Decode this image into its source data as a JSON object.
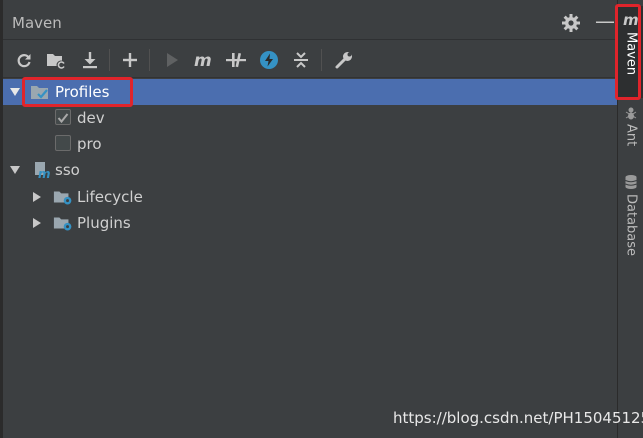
{
  "panel": {
    "title": "Maven",
    "settings_icon": "gear-icon",
    "minimize_label": "—"
  },
  "toolbar": {
    "buttons": [
      {
        "name": "reload-all-button",
        "icon": "refresh-icon"
      },
      {
        "name": "generate-sources-button",
        "icon": "folder-refresh-icon"
      },
      {
        "name": "download-sources-button",
        "icon": "download-icon"
      },
      {
        "name": "add-project-button",
        "icon": "plus-icon"
      },
      {
        "name": "run-button",
        "icon": "play-icon"
      },
      {
        "name": "execute-goal-button",
        "icon": "maven-m-icon"
      },
      {
        "name": "toggle-offline-button",
        "icon": "offline-icon"
      },
      {
        "name": "skip-tests-button",
        "icon": "lightning-icon"
      },
      {
        "name": "collapse-all-button",
        "icon": "collapse-icon"
      },
      {
        "name": "maven-settings-button",
        "icon": "wrench-icon"
      }
    ]
  },
  "tree": {
    "profiles": {
      "label": "Profiles",
      "items": [
        {
          "label": "dev",
          "checked": true
        },
        {
          "label": "pro",
          "checked": false
        }
      ]
    },
    "project": {
      "label": "sso",
      "children": [
        {
          "label": "Lifecycle"
        },
        {
          "label": "Plugins"
        }
      ]
    }
  },
  "sidebar": {
    "items": [
      {
        "label": "Maven",
        "icon": "maven-m-icon",
        "active": true
      },
      {
        "label": "Ant",
        "icon": "ant-icon",
        "active": false
      },
      {
        "label": "Database",
        "icon": "database-icon",
        "active": false
      }
    ]
  },
  "watermark": "https://blog.csdn.net/PH15045125",
  "colors": {
    "background": "#3c3f41",
    "selection": "#4b6eaf",
    "highlight": "#e0242b",
    "text": "#bbbbbb",
    "accent_blue": "#3592c4"
  }
}
